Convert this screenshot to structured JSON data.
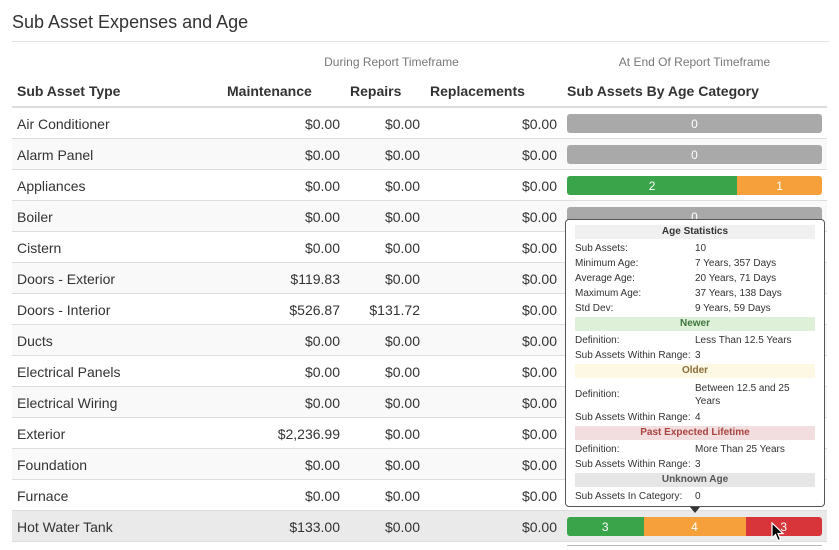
{
  "section": {
    "title": "Sub Asset Expenses and Age",
    "group_during": "During Report Timeframe",
    "group_end": "At End Of Report Timeframe"
  },
  "table": {
    "headers": {
      "type": "Sub Asset Type",
      "maintenance": "Maintenance",
      "repairs": "Repairs",
      "replacements": "Replacements",
      "age": "Sub Assets By Age Category"
    },
    "rows": [
      {
        "type": "Air Conditioner",
        "maintenance": "$0.00",
        "repairs": "$0.00",
        "replacements": "$0.00",
        "segments": [
          {
            "color": "gray",
            "value": "0",
            "frac": 1
          }
        ]
      },
      {
        "type": "Alarm Panel",
        "maintenance": "$0.00",
        "repairs": "$0.00",
        "replacements": "$0.00",
        "segments": [
          {
            "color": "gray",
            "value": "0",
            "frac": 1
          }
        ]
      },
      {
        "type": "Appliances",
        "maintenance": "$0.00",
        "repairs": "$0.00",
        "replacements": "$0.00",
        "segments": [
          {
            "color": "green",
            "value": "2",
            "frac": 0.667
          },
          {
            "color": "orange",
            "value": "1",
            "frac": 0.333
          }
        ]
      },
      {
        "type": "Boiler",
        "maintenance": "$0.00",
        "repairs": "$0.00",
        "replacements": "$0.00",
        "segments": [
          {
            "color": "gray",
            "value": "0",
            "frac": 1
          }
        ]
      },
      {
        "type": "Cistern",
        "maintenance": "$0.00",
        "repairs": "$0.00",
        "replacements": "$0.00",
        "segments": []
      },
      {
        "type": "Doors - Exterior",
        "maintenance": "$119.83",
        "repairs": "$0.00",
        "replacements": "$0.00",
        "segments": []
      },
      {
        "type": "Doors - Interior",
        "maintenance": "$526.87",
        "repairs": "$131.72",
        "replacements": "$0.00",
        "segments": []
      },
      {
        "type": "Ducts",
        "maintenance": "$0.00",
        "repairs": "$0.00",
        "replacements": "$0.00",
        "segments": []
      },
      {
        "type": "Electrical Panels",
        "maintenance": "$0.00",
        "repairs": "$0.00",
        "replacements": "$0.00",
        "segments": []
      },
      {
        "type": "Electrical Wiring",
        "maintenance": "$0.00",
        "repairs": "$0.00",
        "replacements": "$0.00",
        "segments": []
      },
      {
        "type": "Exterior",
        "maintenance": "$2,236.99",
        "repairs": "$0.00",
        "replacements": "$0.00",
        "segments": []
      },
      {
        "type": "Foundation",
        "maintenance": "$0.00",
        "repairs": "$0.00",
        "replacements": "$0.00",
        "segments": []
      },
      {
        "type": "Furnace",
        "maintenance": "$0.00",
        "repairs": "$0.00",
        "replacements": "$0.00",
        "segments": []
      },
      {
        "type": "Hot Water Tank",
        "maintenance": "$133.00",
        "repairs": "$0.00",
        "replacements": "$0.00",
        "segments": [
          {
            "color": "green",
            "value": "3",
            "frac": 0.3
          },
          {
            "color": "orange",
            "value": "4",
            "frac": 0.4
          },
          {
            "color": "red",
            "value": "3",
            "frac": 0.3
          }
        ]
      }
    ]
  },
  "tooltip": {
    "title": "Age Statistics",
    "stats": [
      {
        "label": "Sub Assets:",
        "value": "10"
      },
      {
        "label": "Minimum Age:",
        "value": "7 Years, 357 Days"
      },
      {
        "label": "Average Age:",
        "value": "20 Years, 71 Days"
      },
      {
        "label": "Maximum Age:",
        "value": "37 Years, 138 Days"
      },
      {
        "label": "Std Dev:",
        "value": "9 Years, 59 Days"
      }
    ],
    "newer": {
      "title": "Newer",
      "definition_label": "Definition:",
      "definition": "Less Than 12.5 Years",
      "count_label": "Sub Assets Within Range:",
      "count": "3"
    },
    "older": {
      "title": "Older",
      "definition_label": "Definition:",
      "definition": "Between 12.5 and 25 Years",
      "count_label": "Sub Assets Within Range:",
      "count": "4"
    },
    "past": {
      "title": "Past Expected Lifetime",
      "definition_label": "Definition:",
      "definition": "More Than 25 Years",
      "count_label": "Sub Assets Within Range:",
      "count": "3"
    },
    "unknown": {
      "title": "Unknown Age",
      "count_label": "Sub Assets In Category:",
      "count": "0"
    }
  }
}
